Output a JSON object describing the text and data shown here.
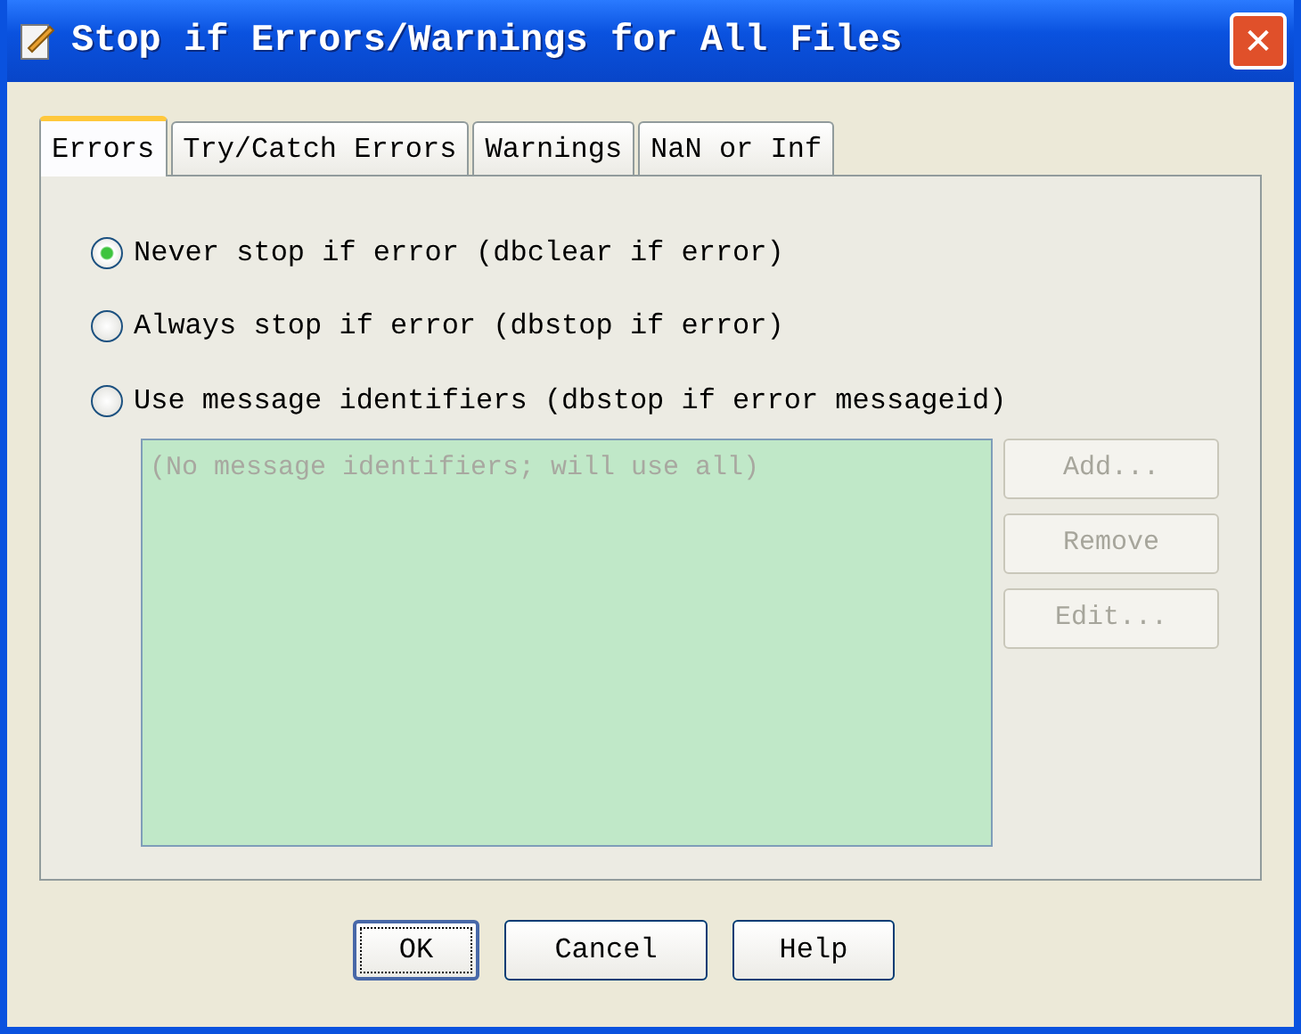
{
  "window": {
    "title": "Stop if Errors/Warnings for All Files",
    "close": "✕"
  },
  "tabs": [
    {
      "label": "Errors",
      "selected": true
    },
    {
      "label": "Try/Catch Errors",
      "selected": false
    },
    {
      "label": "Warnings",
      "selected": false
    },
    {
      "label": "NaN or Inf",
      "selected": false
    }
  ],
  "options": [
    {
      "label": "Never stop if error (dbclear if error)",
      "selected": true
    },
    {
      "label": "Always stop if error (dbstop if error)",
      "selected": false
    },
    {
      "label": "Use message identifiers (dbstop if error messageid)",
      "selected": false
    }
  ],
  "identifiers": {
    "placeholder": "(No message identifiers; will use all)",
    "disabled": true
  },
  "list_buttons": [
    {
      "label": "Add...",
      "disabled": true
    },
    {
      "label": "Remove",
      "disabled": true
    },
    {
      "label": "Edit...",
      "disabled": true
    }
  ],
  "buttons": [
    {
      "label": "OK",
      "focused": true
    },
    {
      "label": "Cancel",
      "focused": false
    },
    {
      "label": "Help",
      "focused": false
    }
  ]
}
